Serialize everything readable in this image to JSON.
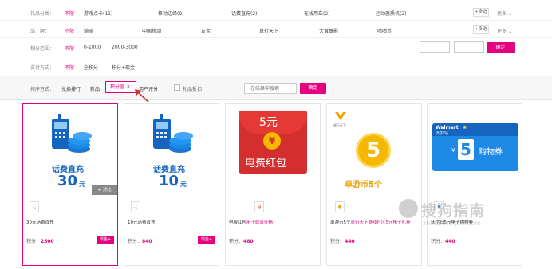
{
  "filters": {
    "gift_category": {
      "label": "礼品分类：",
      "nolimit": "不限",
      "options": [
        "游戏点卡(11)",
        "移动边缘(9)",
        "话费直充(2)",
        "在线用车(2)",
        "运动器质机(2)"
      ],
      "multi": "+多选",
      "more": "更多"
    },
    "brand": {
      "label": "品　牌：",
      "nolimit": "不限",
      "options": [
        "骑骑",
        "中国移动",
        "友宝",
        "卓行天下",
        "大黄蜂影",
        "咕咕币"
      ],
      "multi": "+多选",
      "more": "更多"
    },
    "points_range": {
      "label": "积分范围：",
      "nolimit": "不限",
      "options": [
        "0-1000",
        "2000-3000"
      ],
      "confirm": "确定"
    },
    "payment": {
      "label": "支付方式：",
      "nolimit": "不限",
      "options": [
        "全积分",
        "积分+现金"
      ]
    }
  },
  "sort": {
    "label": "排序方式：",
    "options": [
      "兑换排行",
      "新品",
      "积分值",
      "用户评分"
    ],
    "active": "积分值",
    "checkbox_label": "礼品折扣",
    "search_placeholder": "在结果中搜索",
    "search_button": "确定"
  },
  "products": [
    {
      "art_amount": "30",
      "art_unit": "元",
      "art_text": "话费直充",
      "badge": "⛶",
      "title": "30元话费直充",
      "title_highlight": "",
      "points_label": "积分：",
      "points": "2500",
      "tag": "现金+",
      "overlay": "+ 对比"
    },
    {
      "art_amount": "10",
      "art_unit": "元",
      "art_text": "话费直充",
      "badge": "⛶",
      "title": "10元话费直充",
      "title_highlight": "",
      "points_label": "积分：",
      "points": "840",
      "tag": "现金+",
      "overlay": ""
    },
    {
      "art_amount": "5元",
      "art_text": "电费红包",
      "badge": "▤",
      "title": "电费红包",
      "title_highlight": "用于联合征畅",
      "points_label": "积分：",
      "points": "480",
      "tag": "",
      "overlay": ""
    },
    {
      "art_amount": "5",
      "art_text": "卓游币5个",
      "art_logo": "卓行天下",
      "badge": "●",
      "title": "卓游币5个",
      "title_highlight": "卓行天下游戏社区5元电子礼券",
      "points_label": "积分：",
      "points": "440",
      "tag": "",
      "overlay": ""
    },
    {
      "art_brand": "Walmart",
      "art_brand_cn": "沃尔玛",
      "art_amount": "5",
      "art_text": "购物券",
      "badge": "★",
      "title": "沃尔玛5元电子购物券",
      "title_highlight": "",
      "points_label": "积分：",
      "points": "440",
      "tag": "",
      "overlay": ""
    }
  ],
  "watermark": {
    "main": "搜狗指南",
    "sub": "zhinan.sogou.com"
  },
  "colors": {
    "accent": "#e4007f",
    "blue": "#1565c0",
    "red": "#d32f2f",
    "gold": "#f5b800"
  }
}
